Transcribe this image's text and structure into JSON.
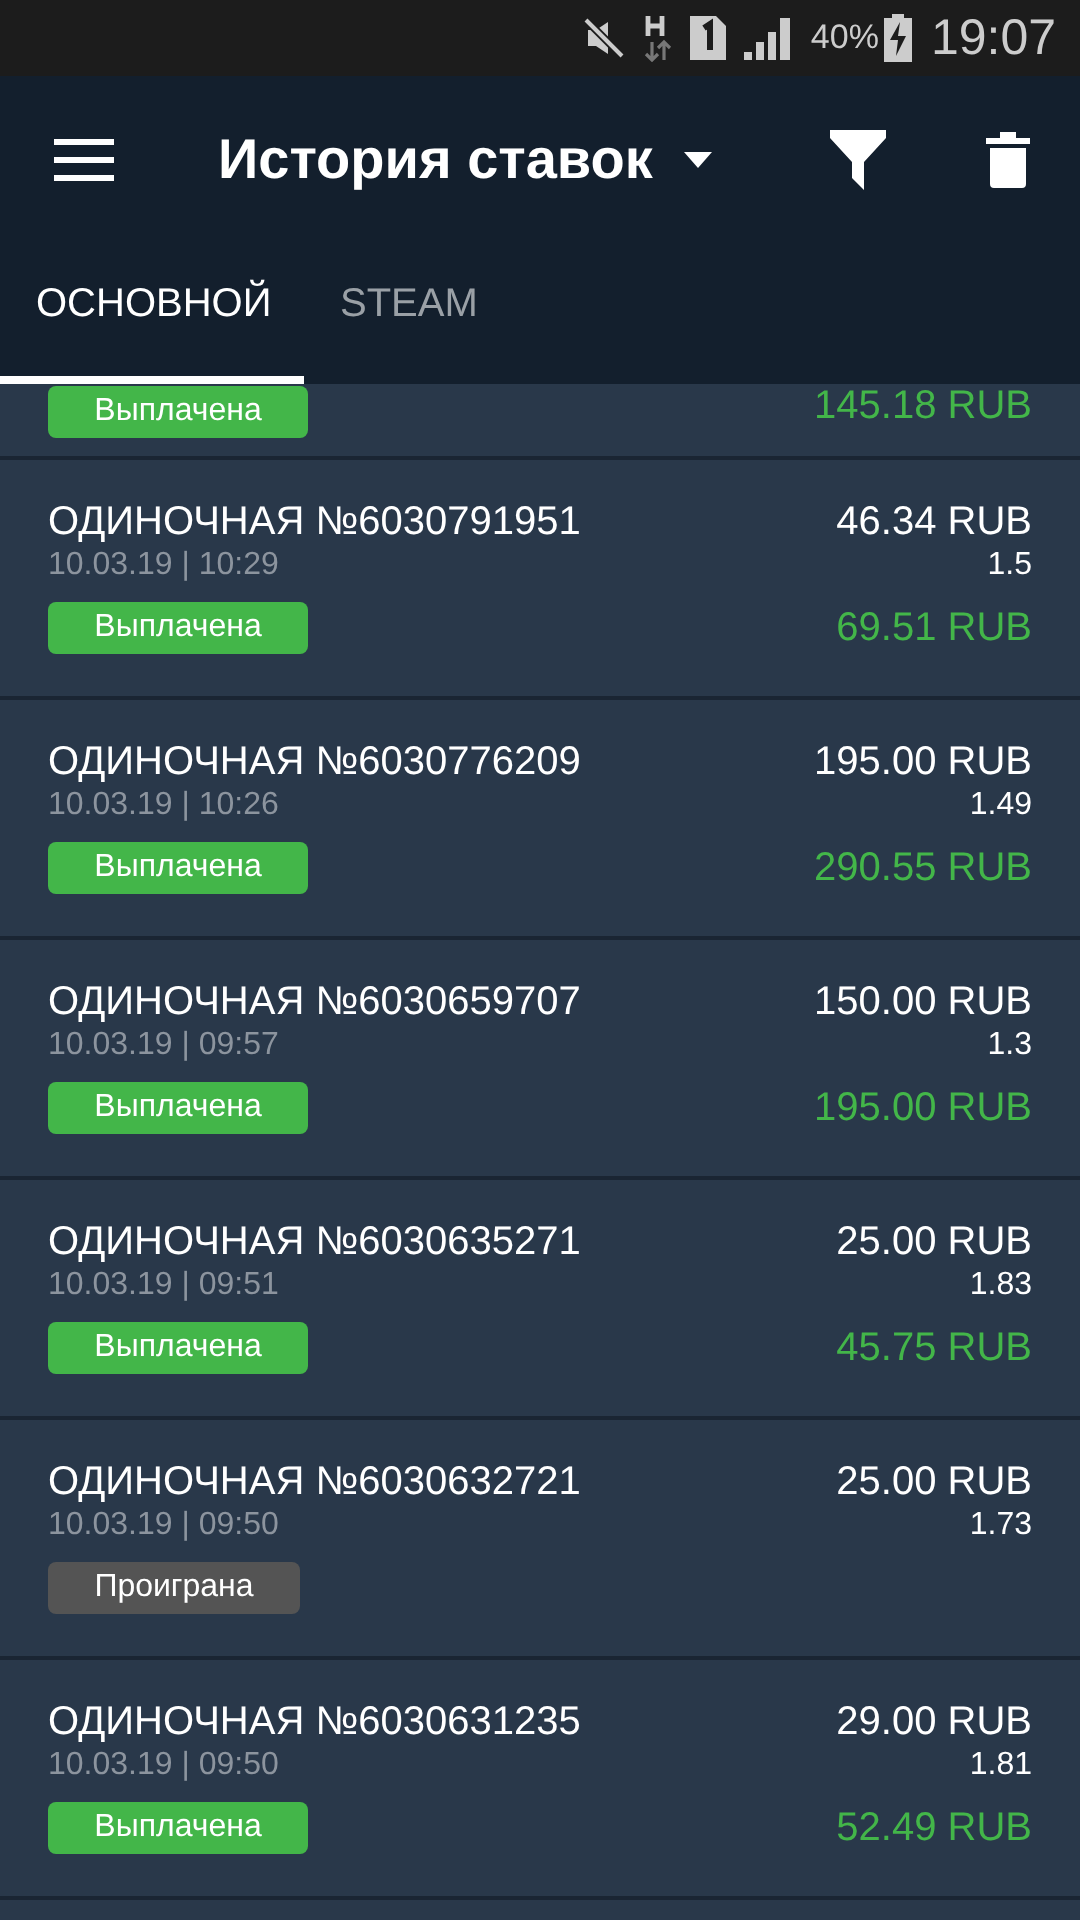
{
  "status_bar": {
    "battery": "40%",
    "time": "19:07"
  },
  "app_bar": {
    "title": "История ставок"
  },
  "tabs": [
    {
      "label": "ОСНОВНОЙ",
      "selected": true
    },
    {
      "label": "STEAM",
      "selected": false
    }
  ],
  "bets": [
    {
      "status": {
        "label": "Выплачена",
        "kind": "paid"
      },
      "payout": "145.18 RUB"
    },
    {
      "title": "ОДИНОЧНАЯ №6030791951",
      "datetime": "10.03.19 | 10:29",
      "stake": "46.34 RUB",
      "odds": "1.5",
      "status": {
        "label": "Выплачена",
        "kind": "paid"
      },
      "payout": "69.51 RUB"
    },
    {
      "title": "ОДИНОЧНАЯ №6030776209",
      "datetime": "10.03.19 | 10:26",
      "stake": "195.00 RUB",
      "odds": "1.49",
      "status": {
        "label": "Выплачена",
        "kind": "paid"
      },
      "payout": "290.55 RUB"
    },
    {
      "title": "ОДИНОЧНАЯ №6030659707",
      "datetime": "10.03.19 | 09:57",
      "stake": "150.00 RUB",
      "odds": "1.3",
      "status": {
        "label": "Выплачена",
        "kind": "paid"
      },
      "payout": "195.00 RUB"
    },
    {
      "title": "ОДИНОЧНАЯ №6030635271",
      "datetime": "10.03.19 | 09:51",
      "stake": "25.00 RUB",
      "odds": "1.83",
      "status": {
        "label": "Выплачена",
        "kind": "paid"
      },
      "payout": "45.75 RUB"
    },
    {
      "title": "ОДИНОЧНАЯ №6030632721",
      "datetime": "10.03.19 | 09:50",
      "stake": "25.00 RUB",
      "odds": "1.73",
      "status": {
        "label": "Проиграна",
        "kind": "lost"
      }
    },
    {
      "title": "ОДИНОЧНАЯ №6030631235",
      "datetime": "10.03.19 | 09:50",
      "stake": "29.00 RUB",
      "odds": "1.81",
      "status": {
        "label": "Выплачена",
        "kind": "paid"
      },
      "payout": "52.49 RUB"
    }
  ]
}
